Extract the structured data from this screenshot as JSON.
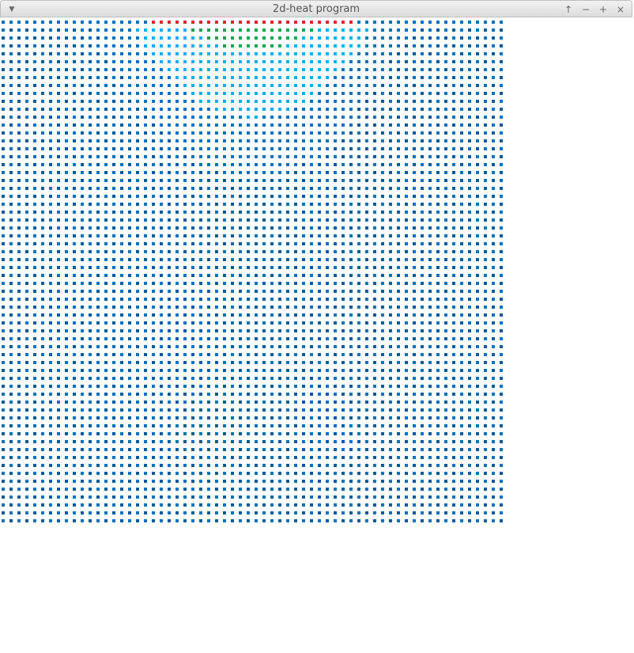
{
  "window": {
    "title": "2d-heat program",
    "menu_icon": "chevron-down-icon",
    "buttons": [
      {
        "name": "shade-button",
        "icon": "arrow-up-icon",
        "glyph": "↑"
      },
      {
        "name": "minimize-button",
        "icon": "minus-icon",
        "glyph": "−"
      },
      {
        "name": "maximize-button",
        "icon": "plus-icon",
        "glyph": "+"
      },
      {
        "name": "close-button",
        "icon": "close-icon",
        "glyph": "×"
      }
    ]
  },
  "heatmap": {
    "columns": 64,
    "rows": 64,
    "hot_row_start_col": 19,
    "hot_row_end_col": 44,
    "colors": {
      "hot": "#d9262b",
      "warm": "#00a651",
      "mid": "#00aeef",
      "cool": "#0072bc",
      "cold": "#005b9a",
      "background": "#ffffff"
    }
  }
}
